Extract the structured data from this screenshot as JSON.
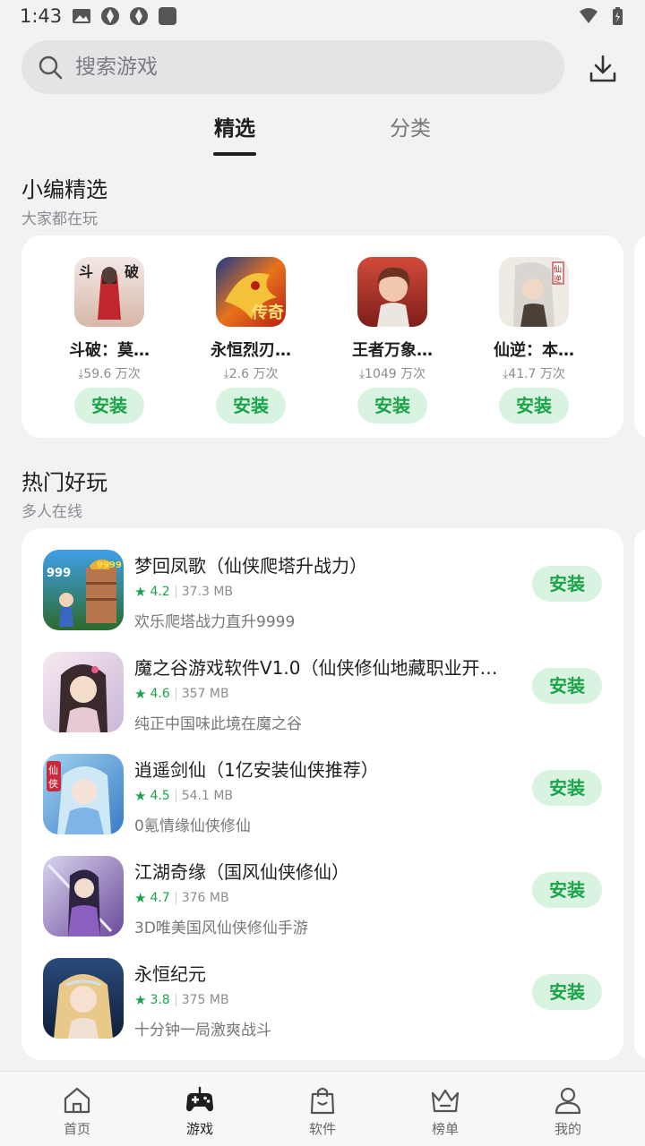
{
  "status_bar": {
    "time": "1:43"
  },
  "search": {
    "placeholder": "搜索游戏"
  },
  "tabs": [
    {
      "label": "精选",
      "active": true
    },
    {
      "label": "分类",
      "active": false
    }
  ],
  "featured": {
    "title": "小编精选",
    "subtitle": "大家都在玩",
    "items": [
      {
        "name": "斗破：莫…",
        "downloads": "⤓59.6 万次",
        "install": "安装"
      },
      {
        "name": "永恒烈刃…",
        "downloads": "⤓2.6 万次",
        "install": "安装"
      },
      {
        "name": "王者万象…",
        "downloads": "⤓1049 万次",
        "install": "安装"
      },
      {
        "name": "仙逆：本…",
        "downloads": "⤓41.7 万次",
        "install": "安装"
      }
    ]
  },
  "hot": {
    "title": "热门好玩",
    "subtitle": "多人在线",
    "items": [
      {
        "title": "梦回凤歌（仙侠爬塔升战力）",
        "rating": "4.2",
        "size": "37.3 MB",
        "desc": "欢乐爬塔战力直升9999",
        "install": "安装"
      },
      {
        "title": "魔之谷游戏软件V1.0（仙侠修仙地藏职业开…",
        "rating": "4.6",
        "size": "357 MB",
        "desc": "纯正中国味此境在魔之谷",
        "install": "安装"
      },
      {
        "title": "逍遥剑仙（1亿安装仙侠推荐）",
        "rating": "4.5",
        "size": "54.1 MB",
        "desc": "0氪情缘仙侠修仙",
        "install": "安装"
      },
      {
        "title": "江湖奇缘（国风仙侠修仙）",
        "rating": "4.7",
        "size": "376 MB",
        "desc": "3D唯美国风仙侠修仙手游",
        "install": "安装"
      },
      {
        "title": "永恒纪元",
        "rating": "3.8",
        "size": "375 MB",
        "desc": "十分钟一局激爽战斗",
        "install": "安装"
      }
    ]
  },
  "nav": [
    {
      "label": "首页",
      "icon": "home-icon",
      "active": false
    },
    {
      "label": "游戏",
      "icon": "gamepad-icon",
      "active": true
    },
    {
      "label": "软件",
      "icon": "bag-icon",
      "active": false
    },
    {
      "label": "榜单",
      "icon": "crown-icon",
      "active": false
    },
    {
      "label": "我的",
      "icon": "person-icon",
      "active": false
    }
  ],
  "colors": {
    "accent": "#1aa34a",
    "install_bg": "#d8f3df",
    "page_bg": "#f1f2f3"
  }
}
